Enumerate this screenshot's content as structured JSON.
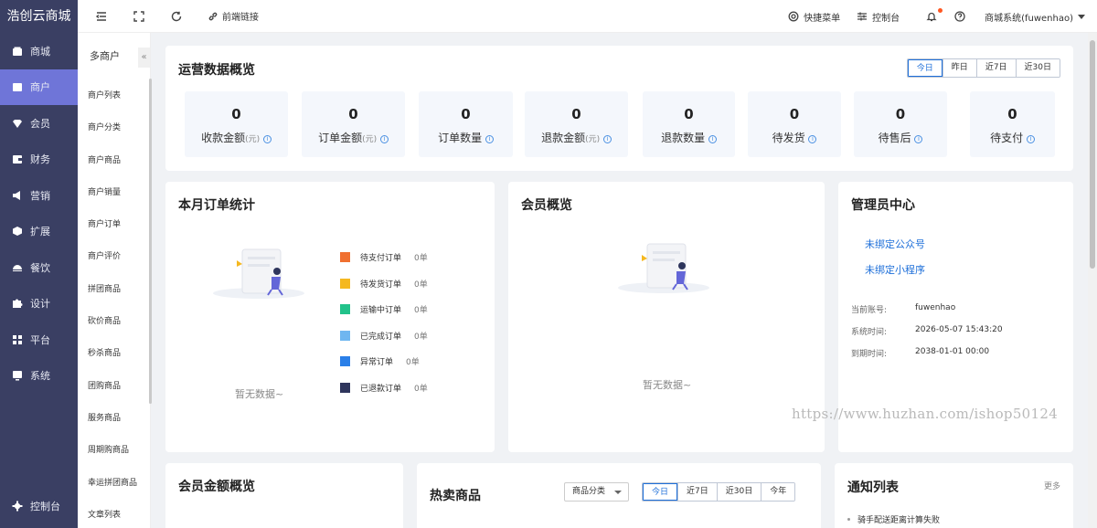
{
  "app": {
    "brand": "浩创云商城"
  },
  "sidebar": {
    "items": [
      {
        "label": "商城",
        "icon": "shop-icon",
        "active": false
      },
      {
        "label": "商户",
        "icon": "merchant-icon",
        "active": true
      },
      {
        "label": "会员",
        "icon": "diamond-icon",
        "active": false
      },
      {
        "label": "财务",
        "icon": "wallet-icon",
        "active": false
      },
      {
        "label": "营销",
        "icon": "megaphone-icon",
        "active": false
      },
      {
        "label": "扩展",
        "icon": "cube-icon",
        "active": false
      },
      {
        "label": "餐饮",
        "icon": "dish-icon",
        "active": false
      },
      {
        "label": "设计",
        "icon": "puzzle-icon",
        "active": false
      },
      {
        "label": "平台",
        "icon": "grid-icon",
        "active": false
      },
      {
        "label": "系统",
        "icon": "monitor-icon",
        "active": false
      }
    ],
    "bottom": {
      "label": "控制台",
      "icon": "gear-icon"
    }
  },
  "subbar": {
    "title": "多商户",
    "collapse_icon": "«",
    "items": [
      "商户列表",
      "商户分类",
      "商户商品",
      "商户销量",
      "商户订单",
      "商户评价",
      "拼团商品",
      "砍价商品",
      "秒杀商品",
      "团购商品",
      "服务商品",
      "周期购商品",
      "幸运拼团商品",
      "文章列表"
    ]
  },
  "topbar": {
    "front_link": "前端链接",
    "quick_menu": "快捷菜单",
    "console": "控制台",
    "account": "商城系统(fuwenhao)"
  },
  "overview": {
    "title": "运营数据概览",
    "ranges": [
      "今日",
      "昨日",
      "近7日",
      "近30日"
    ],
    "active_range": "今日",
    "stats": [
      {
        "value": "0",
        "label": "收款金额",
        "unit": "(元)"
      },
      {
        "value": "0",
        "label": "订单金额",
        "unit": "(元)"
      },
      {
        "value": "0",
        "label": "订单数量",
        "unit": ""
      },
      {
        "value": "0",
        "label": "退款金额",
        "unit": "(元)"
      },
      {
        "value": "0",
        "label": "退款数量",
        "unit": ""
      },
      {
        "value": "0",
        "label": "待发货",
        "unit": ""
      },
      {
        "value": "0",
        "label": "待售后",
        "unit": ""
      },
      {
        "value": "0",
        "label": "待支付",
        "unit": ""
      }
    ],
    "info_icon": "i"
  },
  "monthly_orders": {
    "title": "本月订单统计",
    "empty": "暂无数据~",
    "legend": [
      {
        "label": "待支付订单",
        "count": "0单",
        "color": "#f07030"
      },
      {
        "label": "待发货订单",
        "count": "0单",
        "color": "#f5b820"
      },
      {
        "label": "运输中订单",
        "count": "0单",
        "color": "#22c28a"
      },
      {
        "label": "已完成订单",
        "count": "0单",
        "color": "#6fb6f0"
      },
      {
        "label": "异常订单",
        "count": "0单",
        "color": "#2a7fe8"
      },
      {
        "label": "已退款订单",
        "count": "0单",
        "color": "#2e355c"
      }
    ]
  },
  "member_overview": {
    "title": "会员概览",
    "empty": "暂无数据~"
  },
  "admin_center": {
    "title": "管理员中心",
    "links": [
      "未绑定公众号",
      "未绑定小程序"
    ],
    "rows": [
      {
        "key": "当前账号:",
        "value": "fuwenhao"
      },
      {
        "key": "系统时间:",
        "value": "2026-05-07 15:43:20"
      },
      {
        "key": "到期时间:",
        "value": "2038-01-01 00:00"
      }
    ]
  },
  "member_amount": {
    "title": "会员金额概览"
  },
  "hot_products": {
    "title": "热卖商品",
    "category_select": "商品分类",
    "ranges": [
      "今日",
      "近7日",
      "近30日",
      "今年"
    ],
    "active_range": "今日"
  },
  "notifications": {
    "title": "通知列表",
    "more": "更多",
    "items": [
      "骑手配送距离计算失败"
    ]
  },
  "watermark": "https://www.huzhan.com/ishop50124"
}
